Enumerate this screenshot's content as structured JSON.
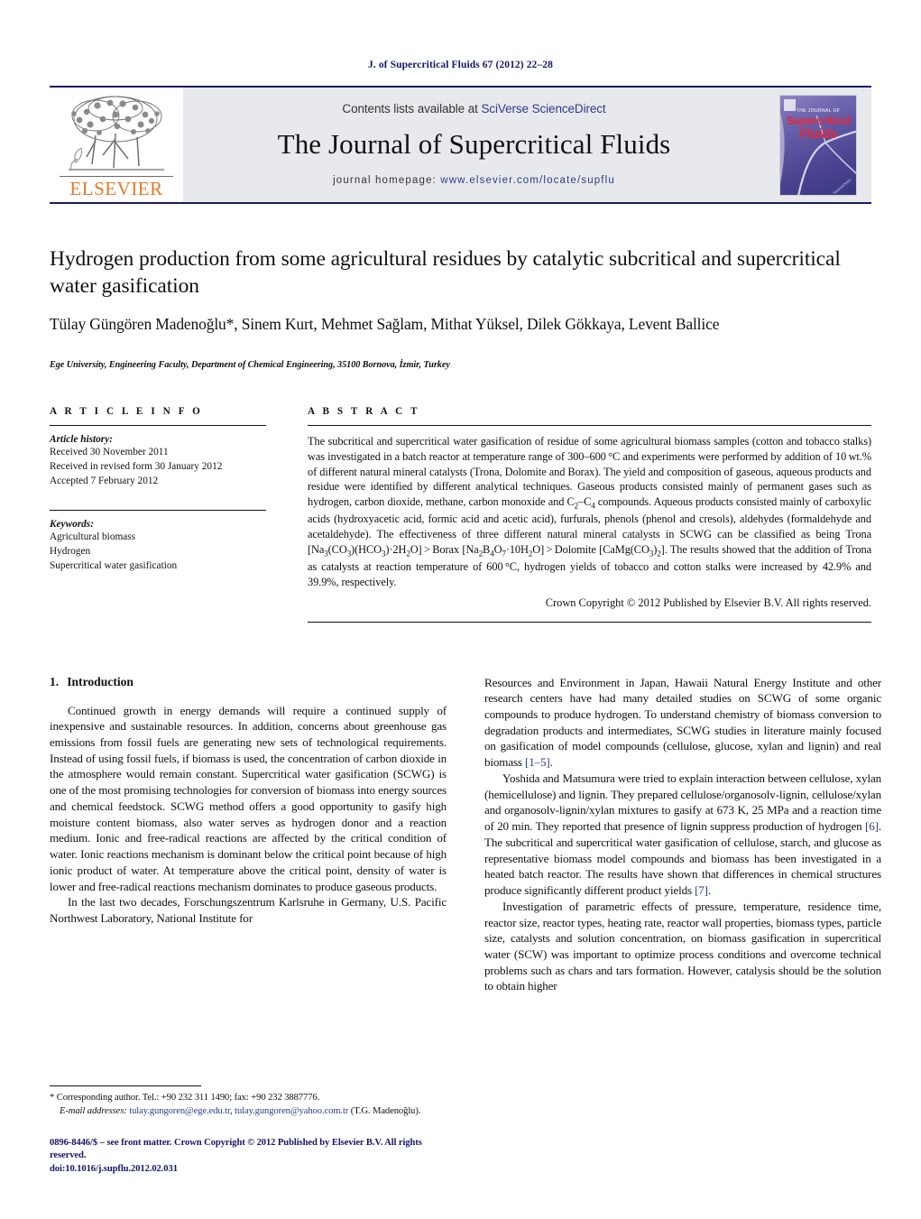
{
  "running_head": "J. of Supercritical Fluids 67 (2012) 22–28",
  "masthead": {
    "contents_prefix": "Contents lists available at ",
    "contents_link": "SciVerse ScienceDirect",
    "journal_name": "The Journal of Supercritical Fluids",
    "homepage_label": "journal homepage:",
    "homepage_url": "www.elsevier.com/locate/supflu",
    "publisher": "ELSEVIER",
    "cover": {
      "line1": "THE JOURNAL OF",
      "line2": "Supercritical",
      "line3": "Fluids",
      "imprint": "ScienceDirect"
    }
  },
  "article": {
    "title": "Hydrogen production from some agricultural residues by catalytic subcritical and supercritical water gasification",
    "authors": "Tülay Güngören Madenoğlu*, Sinem Kurt, Mehmet Sağlam, Mithat Yüksel, Dilek Gökkaya, Levent Ballice",
    "affiliation": "Ege University, Engineering Faculty, Department of Chemical Engineering, 35100 Bornova, İzmir, Turkey"
  },
  "article_info": {
    "heading": "A R T I C L E   I N F O",
    "history_label": "Article history:",
    "history": [
      "Received 30 November 2011",
      "Received in revised form 30 January 2012",
      "Accepted 7 February 2012"
    ],
    "keywords_label": "Keywords:",
    "keywords": [
      "Agricultural biomass",
      "Hydrogen",
      "Supercritical water gasification"
    ]
  },
  "abstract": {
    "heading": "A B S T R A C T",
    "copyright": "Crown Copyright © 2012 Published by Elsevier B.V. All rights reserved."
  },
  "introduction": {
    "heading_num": "1.",
    "heading_text": "Introduction",
    "left_para_1": "Continued growth in energy demands will require a continued supply of inexpensive and sustainable resources. In addition, concerns about greenhouse gas emissions from fossil fuels are generating new sets of technological requirements. Instead of using fossil fuels, if biomass is used, the concentration of carbon dioxide in the atmosphere would remain constant. Supercritical water gasification (SCWG) is one of the most promising technologies for conversion of biomass into energy sources and chemical feedstock. SCWG method offers a good opportunity to gasify high moisture content biomass, also water serves as hydrogen donor and a reaction medium. Ionic and free-radical reactions are affected by the critical condition of water. Ionic reactions mechanism is dominant below the critical point because of high ionic product of water. At temperature above the critical point, density of water is lower and free-radical reactions mechanism dominates to produce gaseous products.",
    "left_para_2": "In the last two decades, Forschungszentrum Karlsruhe in Germany, U.S. Pacific Northwest Laboratory, National Institute for",
    "right_para_1_a": "Resources and Environment in Japan, Hawaii Natural Energy Institute and other research centers have had many detailed studies on SCWG of some organic compounds to produce hydrogen. To understand chemistry of biomass conversion to degradation products and intermediates, SCWG studies in literature mainly focused on gasification of model compounds (cellulose, glucose, xylan and lignin) and real biomass ",
    "right_para_1_cite": "[1–5]",
    "right_para_1_b": ".",
    "right_para_2_a": "Yoshida and Matsumura were tried to explain interaction between cellulose, xylan (hemicellulose) and lignin. They prepared cellulose/organosolv-lignin, cellulose/xylan and organosolv-lignin/xylan mixtures to gasify at 673 K, 25 MPa and a reaction time of 20 min. They reported that presence of lignin suppress production of hydrogen ",
    "right_para_2_cite": "[6]",
    "right_para_2_b": ". The subcritical and supercritical water gasification of cellulose, starch, and glucose as representative biomass model compounds and biomass has been investigated in a heated batch reactor. The results have shown that differences in chemical structures produce significantly different product yields ",
    "right_para_2_cite2": "[7]",
    "right_para_2_c": ".",
    "right_para_3": "Investigation of parametric effects of pressure, temperature, residence time, reactor size, reactor types, heating rate, reactor wall properties, biomass types, particle size, catalysts and solution concentration, on biomass gasification in supercritical water (SCW) was important to optimize process conditions and overcome technical problems such as chars and tars formation. However, catalysis should be the solution to obtain higher"
  },
  "footnotes": {
    "corresponding": "* Corresponding author. Tel.: +90 232 311 1490; fax: +90 232 3887776.",
    "email_label": "E-mail addresses:",
    "email_1": "tulay.gungoren@ege.edu.tr",
    "email_2": "tulay.gungoren@yahoo.com.tr",
    "email_owner": "(T.G. Madenoğlu)."
  },
  "footer": {
    "issn_line": "0896-8446/$ – see front matter. Crown Copyright © 2012 Published by Elsevier B.V. All rights reserved.",
    "doi_line": "doi:10.1016/j.supflu.2012.02.031"
  },
  "colors": {
    "link": "#2b3c8f",
    "navy": "#17166b",
    "elsevier_orange": "#e87722",
    "cover_red": "#e8273c",
    "masthead_bg": "#e7e9ec"
  }
}
